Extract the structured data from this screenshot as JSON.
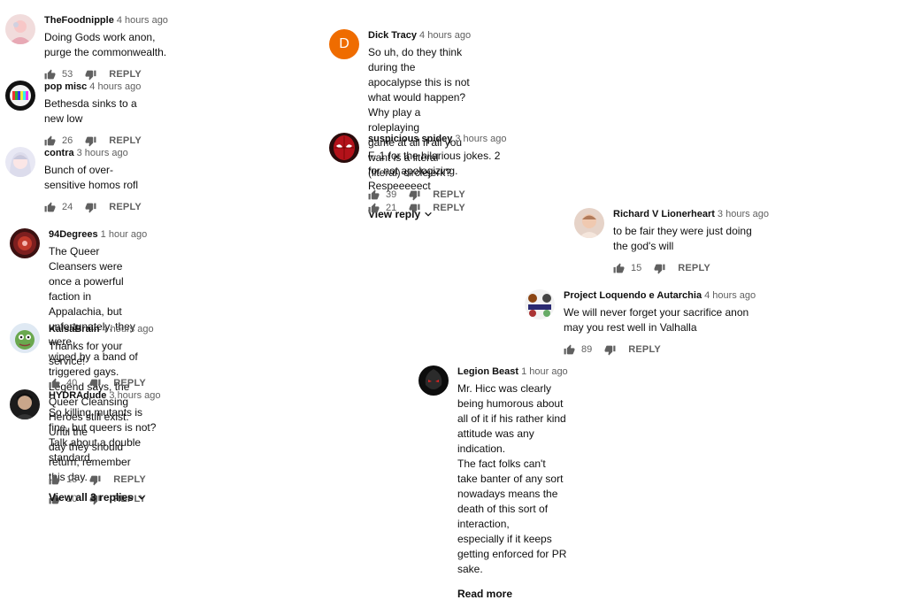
{
  "comments": [
    {
      "author": "TheFoodnipple",
      "time": "4 hours ago",
      "text": "Doing Gods work anon, purge the commonwealth.",
      "likes": "53",
      "reply_label": "REPLY"
    },
    {
      "author": "pop misc",
      "time": "4 hours ago",
      "text": "Bethesda sinks to a new low",
      "likes": "26",
      "reply_label": "REPLY"
    },
    {
      "author": "contra",
      "time": "3 hours ago",
      "text": "Bunch of over-sensitive homos rofl",
      "likes": "24",
      "reply_label": "REPLY"
    },
    {
      "author": "Dick Tracy",
      "time": "4 hours ago",
      "avatar_letter": "D",
      "text_lines": [
        "So uh, do they think during the apocalypse this is not what would happen? Why play a roleplaying",
        "game at all if all you want is a literal (literal) circlejerk?"
      ],
      "likes": "39",
      "reply_label": "REPLY",
      "more_label": "View reply"
    },
    {
      "author": "suspicious spidey",
      "time": "3 hours ago",
      "text": "F. 1 for the hilarious jokes. 2 for not apologizing. Respeeeeect",
      "likes": "21",
      "reply_label": "REPLY"
    },
    {
      "author": "94Degrees",
      "time": "1 hour ago",
      "text_lines": [
        "The Queer Cleansers were once a powerful faction in Appalachia, but unfortunately, they were",
        "wiped by a band of triggered gays. Legend says, the Queer Cleansing Heroes still exist. Until the",
        "day they should return, remember this day."
      ],
      "likes": "10",
      "reply_label": "REPLY"
    },
    {
      "author": "KalsaBrain",
      "time": "4 hours ago",
      "text": "Thanks for your service!",
      "likes": "40",
      "reply_label": "REPLY"
    },
    {
      "author": "HYDRAdude",
      "time": "3 hours ago",
      "text": "So killing mutants is fine, but queers is not? Talk about a double standard.",
      "likes": "18",
      "reply_label": "REPLY",
      "more_label": "View all 3 replies"
    },
    {
      "author": "Richard V Lionerheart",
      "time": "3 hours ago",
      "text": "to be fair they were just doing the god's will",
      "likes": "15",
      "reply_label": "REPLY"
    },
    {
      "author": "Project Loquendo e Autarchia",
      "time": "4 hours ago",
      "text": "We will never forget your sacrifice anon may you rest well in Valhalla",
      "likes": "89",
      "reply_label": "REPLY"
    },
    {
      "author": "Legion Beast",
      "time": "1 hour ago",
      "text_lines": [
        "Mr. Hicc was clearly being humorous about all of it if his rather kind attitude was any indication.",
        "The fact folks can't take banter of any sort nowadays means the death of this sort of interaction,",
        "especially if it keeps getting enforced for PR sake."
      ],
      "more_label": "Read more"
    }
  ],
  "colors": {
    "text": "#0f0f0f",
    "muted": "#606060",
    "dick_tracy_avatar": "#ef6c00"
  },
  "icons": {
    "like": "thumb-up-icon",
    "dislike": "thumb-down-icon",
    "expand": "chevron-down-icon"
  }
}
